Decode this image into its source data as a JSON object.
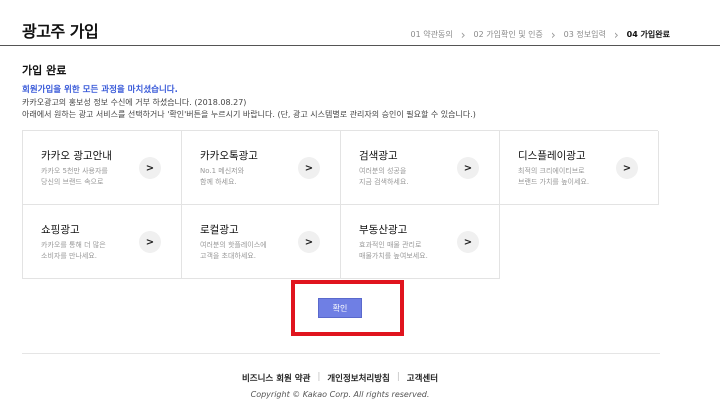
{
  "header": {
    "title": "광고주 가입",
    "steps": [
      "01 약관동의",
      "02 가입확인 및 인증",
      "03 정보입력",
      "04 가입완료"
    ],
    "separator": "›"
  },
  "section": {
    "title": "가입 완료",
    "message_main": "회원가입을 위한 모든 과정을 마치셨습니다.",
    "message_line2": "카카오광고의 홍보성 정보 수신에 거부 하셨습니다. (2018.08.27)",
    "message_line3": "아래에서 원하는 광고 서비스를 선택하거나 '확인'버튼을 누르시기 바랍니다. (단, 광고 시스템별로 관리자의 승인이 필요할 수 있습니다.)"
  },
  "services": [
    {
      "title": "카카오 광고안내",
      "desc": "카카오 5천만 사용자를\n당신의 브랜드 속으로"
    },
    {
      "title": "카카오톡광고",
      "desc": "No.1 메신저와\n함께 하세요."
    },
    {
      "title": "검색광고",
      "desc": "여러분의 성공을\n지금 검색하세요."
    },
    {
      "title": "디스플레이광고",
      "desc": "최적의 크리에이티브로\n브랜드 가치를 높이세요."
    },
    {
      "title": "쇼핑광고",
      "desc": "카카오를 통해 더 많은\n소비자를 만나세요."
    },
    {
      "title": "로컬광고",
      "desc": "여러분의 핫플레이스에\n고객을 초대하세요."
    },
    {
      "title": "부동산광고",
      "desc": "효과적인 매물 관리로\n매물가치를 높여보세요."
    }
  ],
  "arrow_glyph": ">",
  "confirm_label": "확인",
  "footer": {
    "links": [
      "비즈니스 회원 약관",
      "개인정보처리방침",
      "고객센터"
    ],
    "separator": "|",
    "copyright": "Copyright © Kakao Corp. All rights reserved."
  },
  "colors": {
    "accent": "#3a5bd9",
    "button": "#6f7fe4",
    "highlight": "#e0141e"
  }
}
